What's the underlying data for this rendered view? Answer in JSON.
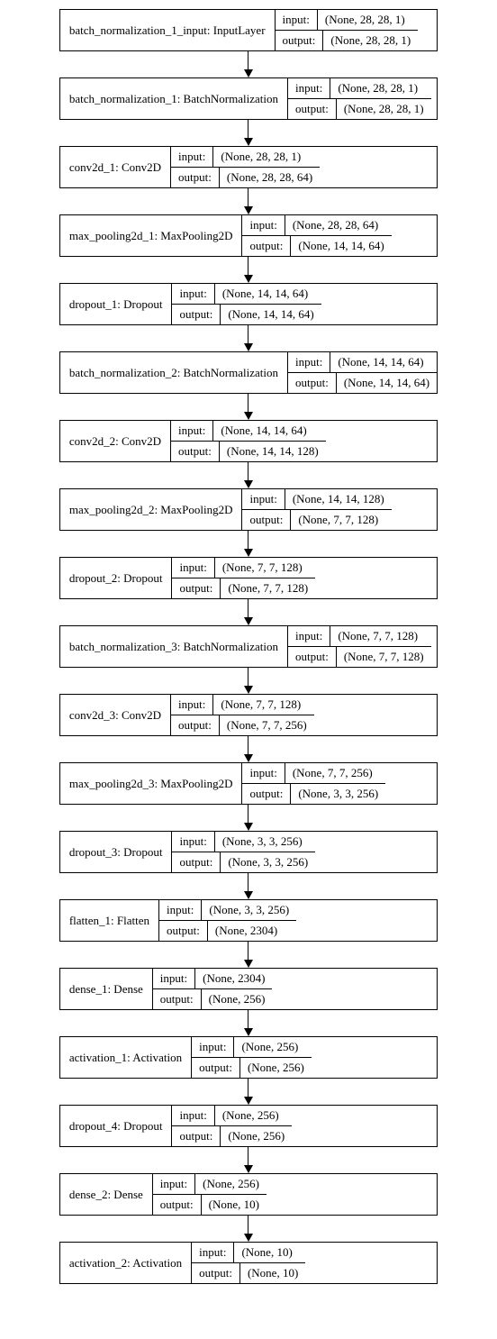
{
  "layers": [
    {
      "name": "batch_normalization_1_input: InputLayer",
      "input": "(None, 28, 28, 1)",
      "output": "(None, 28, 28, 1)"
    },
    {
      "name": "batch_normalization_1: BatchNormalization",
      "input": "(None, 28, 28, 1)",
      "output": "(None, 28, 28, 1)"
    },
    {
      "name": "conv2d_1: Conv2D",
      "input": "(None, 28, 28, 1)",
      "output": "(None, 28, 28, 64)"
    },
    {
      "name": "max_pooling2d_1: MaxPooling2D",
      "input": "(None, 28, 28, 64)",
      "output": "(None, 14, 14, 64)"
    },
    {
      "name": "dropout_1: Dropout",
      "input": "(None, 14, 14, 64)",
      "output": "(None, 14, 14, 64)"
    },
    {
      "name": "batch_normalization_2: BatchNormalization",
      "input": "(None, 14, 14, 64)",
      "output": "(None, 14, 14, 64)"
    },
    {
      "name": "conv2d_2: Conv2D",
      "input": "(None, 14, 14, 64)",
      "output": "(None, 14, 14, 128)"
    },
    {
      "name": "max_pooling2d_2: MaxPooling2D",
      "input": "(None, 14, 14, 128)",
      "output": "(None, 7, 7, 128)"
    },
    {
      "name": "dropout_2: Dropout",
      "input": "(None, 7, 7, 128)",
      "output": "(None, 7, 7, 128)"
    },
    {
      "name": "batch_normalization_3: BatchNormalization",
      "input": "(None, 7, 7, 128)",
      "output": "(None, 7, 7, 128)"
    },
    {
      "name": "conv2d_3: Conv2D",
      "input": "(None, 7, 7, 128)",
      "output": "(None, 7, 7, 256)"
    },
    {
      "name": "max_pooling2d_3: MaxPooling2D",
      "input": "(None, 7, 7, 256)",
      "output": "(None, 3, 3, 256)"
    },
    {
      "name": "dropout_3: Dropout",
      "input": "(None, 3, 3, 256)",
      "output": "(None, 3, 3, 256)"
    },
    {
      "name": "flatten_1: Flatten",
      "input": "(None, 3, 3, 256)",
      "output": "(None, 2304)"
    },
    {
      "name": "dense_1: Dense",
      "input": "(None, 2304)",
      "output": "(None, 256)"
    },
    {
      "name": "activation_1: Activation",
      "input": "(None, 256)",
      "output": "(None, 256)"
    },
    {
      "name": "dropout_4: Dropout",
      "input": "(None, 256)",
      "output": "(None, 256)"
    },
    {
      "name": "dense_2: Dense",
      "input": "(None, 256)",
      "output": "(None, 10)"
    },
    {
      "name": "activation_2: Activation",
      "input": "(None, 10)",
      "output": "(None, 10)"
    }
  ],
  "labels": {
    "input": "input:",
    "output": "output:"
  }
}
